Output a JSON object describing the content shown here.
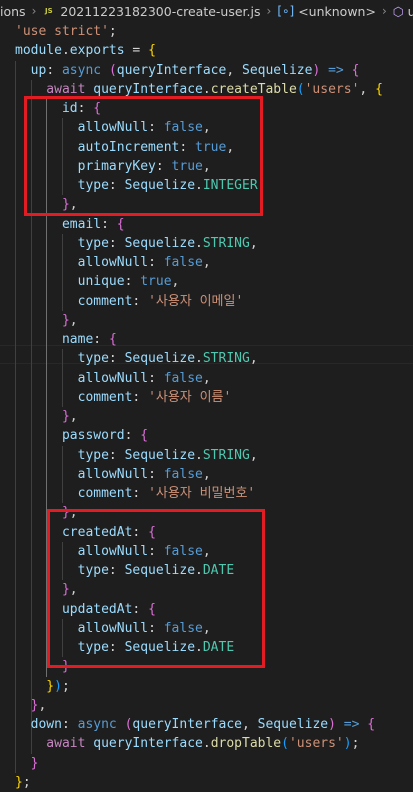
{
  "breadcrumb": {
    "folder": "ions",
    "file_icon_label": "JS",
    "file": "20211223182300-create-user.js",
    "symbol": "<unknown>",
    "member": "up"
  },
  "code_lines": [
    [
      [
        "'use strict'",
        "s"
      ],
      [
        ";",
        "p"
      ]
    ],
    [
      [
        "module",
        "v"
      ],
      [
        ".",
        "p"
      ],
      [
        "exports",
        "v"
      ],
      [
        " = ",
        "p"
      ],
      [
        "{",
        "y"
      ]
    ],
    [
      [
        "  up",
        "v"
      ],
      [
        ": ",
        "p"
      ],
      [
        "async",
        "k"
      ],
      [
        " ",
        "p"
      ],
      [
        "(",
        "m"
      ],
      [
        "queryInterface",
        "v"
      ],
      [
        ", ",
        "p"
      ],
      [
        "Sequelize",
        "v"
      ],
      [
        ")",
        "m"
      ],
      [
        " => ",
        "k"
      ],
      [
        "{",
        "m"
      ]
    ],
    [
      [
        "    await ",
        "t"
      ],
      [
        "queryInterface",
        "v"
      ],
      [
        ".",
        "p"
      ],
      [
        "createTable",
        "f"
      ],
      [
        "(",
        "b"
      ],
      [
        "'users'",
        "s"
      ],
      [
        ", ",
        "p"
      ],
      [
        "{",
        "y"
      ]
    ],
    [
      [
        "      id",
        "v"
      ],
      [
        ": ",
        "p"
      ],
      [
        "{",
        "m"
      ]
    ],
    [
      [
        "        allowNull",
        "v"
      ],
      [
        ": ",
        "p"
      ],
      [
        "false",
        "k"
      ],
      [
        ",",
        "p"
      ]
    ],
    [
      [
        "        autoIncrement",
        "v"
      ],
      [
        ": ",
        "p"
      ],
      [
        "true",
        "k"
      ],
      [
        ",",
        "p"
      ]
    ],
    [
      [
        "        primaryKey",
        "v"
      ],
      [
        ": ",
        "p"
      ],
      [
        "true",
        "k"
      ],
      [
        ",",
        "p"
      ]
    ],
    [
      [
        "        type",
        "v"
      ],
      [
        ": ",
        "p"
      ],
      [
        "Sequelize",
        "v"
      ],
      [
        ".",
        "p"
      ],
      [
        "INTEGER",
        "c"
      ]
    ],
    [
      [
        "      }",
        "m"
      ],
      [
        ",",
        "p"
      ]
    ],
    [
      [
        "      email",
        "v"
      ],
      [
        ": ",
        "p"
      ],
      [
        "{",
        "m"
      ]
    ],
    [
      [
        "        type",
        "v"
      ],
      [
        ": ",
        "p"
      ],
      [
        "Sequelize",
        "v"
      ],
      [
        ".",
        "p"
      ],
      [
        "STRING",
        "c"
      ],
      [
        ",",
        "p"
      ]
    ],
    [
      [
        "        allowNull",
        "v"
      ],
      [
        ": ",
        "p"
      ],
      [
        "false",
        "k"
      ],
      [
        ",",
        "p"
      ]
    ],
    [
      [
        "        unique",
        "v"
      ],
      [
        ": ",
        "p"
      ],
      [
        "true",
        "k"
      ],
      [
        ",",
        "p"
      ]
    ],
    [
      [
        "        comment",
        "v"
      ],
      [
        ": ",
        "p"
      ],
      [
        "'사용자 이메일'",
        "s"
      ]
    ],
    [
      [
        "      }",
        "m"
      ],
      [
        ",",
        "p"
      ]
    ],
    [
      [
        "      name",
        "v"
      ],
      [
        ": ",
        "p"
      ],
      [
        "{",
        "m"
      ]
    ],
    [
      [
        "        type",
        "v"
      ],
      [
        ": ",
        "p"
      ],
      [
        "Sequelize",
        "v"
      ],
      [
        ".",
        "p"
      ],
      [
        "STRING",
        "c"
      ],
      [
        ",",
        "p"
      ]
    ],
    [
      [
        "        allowNull",
        "v"
      ],
      [
        ": ",
        "p"
      ],
      [
        "false",
        "k"
      ],
      [
        ",",
        "p"
      ]
    ],
    [
      [
        "        comment",
        "v"
      ],
      [
        ": ",
        "p"
      ],
      [
        "'사용자 이름'",
        "s"
      ]
    ],
    [
      [
        "      }",
        "m"
      ],
      [
        ",",
        "p"
      ]
    ],
    [
      [
        "      password",
        "v"
      ],
      [
        ": ",
        "p"
      ],
      [
        "{",
        "m"
      ]
    ],
    [
      [
        "        type",
        "v"
      ],
      [
        ": ",
        "p"
      ],
      [
        "Sequelize",
        "v"
      ],
      [
        ".",
        "p"
      ],
      [
        "STRING",
        "c"
      ],
      [
        ",",
        "p"
      ]
    ],
    [
      [
        "        allowNull",
        "v"
      ],
      [
        ": ",
        "p"
      ],
      [
        "false",
        "k"
      ],
      [
        ",",
        "p"
      ]
    ],
    [
      [
        "        comment",
        "v"
      ],
      [
        ": ",
        "p"
      ],
      [
        "'사용자 비밀번호'",
        "s"
      ]
    ],
    [
      [
        "      }",
        "m"
      ],
      [
        ",",
        "p"
      ]
    ],
    [
      [
        "      createdAt",
        "v"
      ],
      [
        ": ",
        "p"
      ],
      [
        "{",
        "m"
      ]
    ],
    [
      [
        "        allowNull",
        "v"
      ],
      [
        ": ",
        "p"
      ],
      [
        "false",
        "k"
      ],
      [
        ",",
        "p"
      ]
    ],
    [
      [
        "        type",
        "v"
      ],
      [
        ": ",
        "p"
      ],
      [
        "Sequelize",
        "v"
      ],
      [
        ".",
        "p"
      ],
      [
        "DATE",
        "c"
      ]
    ],
    [
      [
        "      }",
        "m"
      ],
      [
        ",",
        "p"
      ]
    ],
    [
      [
        "      updatedAt",
        "v"
      ],
      [
        ": ",
        "p"
      ],
      [
        "{",
        "m"
      ]
    ],
    [
      [
        "        allowNull",
        "v"
      ],
      [
        ": ",
        "p"
      ],
      [
        "false",
        "k"
      ],
      [
        ",",
        "p"
      ]
    ],
    [
      [
        "        type",
        "v"
      ],
      [
        ": ",
        "p"
      ],
      [
        "Sequelize",
        "v"
      ],
      [
        ".",
        "p"
      ],
      [
        "DATE",
        "c"
      ]
    ],
    [
      [
        "      }",
        "m"
      ]
    ],
    [
      [
        "    }",
        "y"
      ],
      [
        ")",
        "b"
      ],
      [
        ";",
        "p"
      ]
    ],
    [
      [
        "  }",
        "m"
      ],
      [
        ",",
        "p"
      ]
    ],
    [
      [
        "  down",
        "v"
      ],
      [
        ": ",
        "p"
      ],
      [
        "async",
        "k"
      ],
      [
        " ",
        "p"
      ],
      [
        "(",
        "m"
      ],
      [
        "queryInterface",
        "v"
      ],
      [
        ", ",
        "p"
      ],
      [
        "Sequelize",
        "v"
      ],
      [
        ")",
        "m"
      ],
      [
        " => ",
        "k"
      ],
      [
        "{",
        "m"
      ]
    ],
    [
      [
        "    await ",
        "t"
      ],
      [
        "queryInterface",
        "v"
      ],
      [
        ".",
        "p"
      ],
      [
        "dropTable",
        "f"
      ],
      [
        "(",
        "b"
      ],
      [
        "'users'",
        "s"
      ],
      [
        ")",
        "b"
      ],
      [
        ";",
        "p"
      ]
    ],
    [
      [
        "  }",
        "m"
      ]
    ],
    [
      [
        "}",
        "y"
      ],
      [
        ";",
        "p"
      ]
    ]
  ],
  "highlights": [
    "id-block",
    "createdAt-updatedAt-block"
  ]
}
